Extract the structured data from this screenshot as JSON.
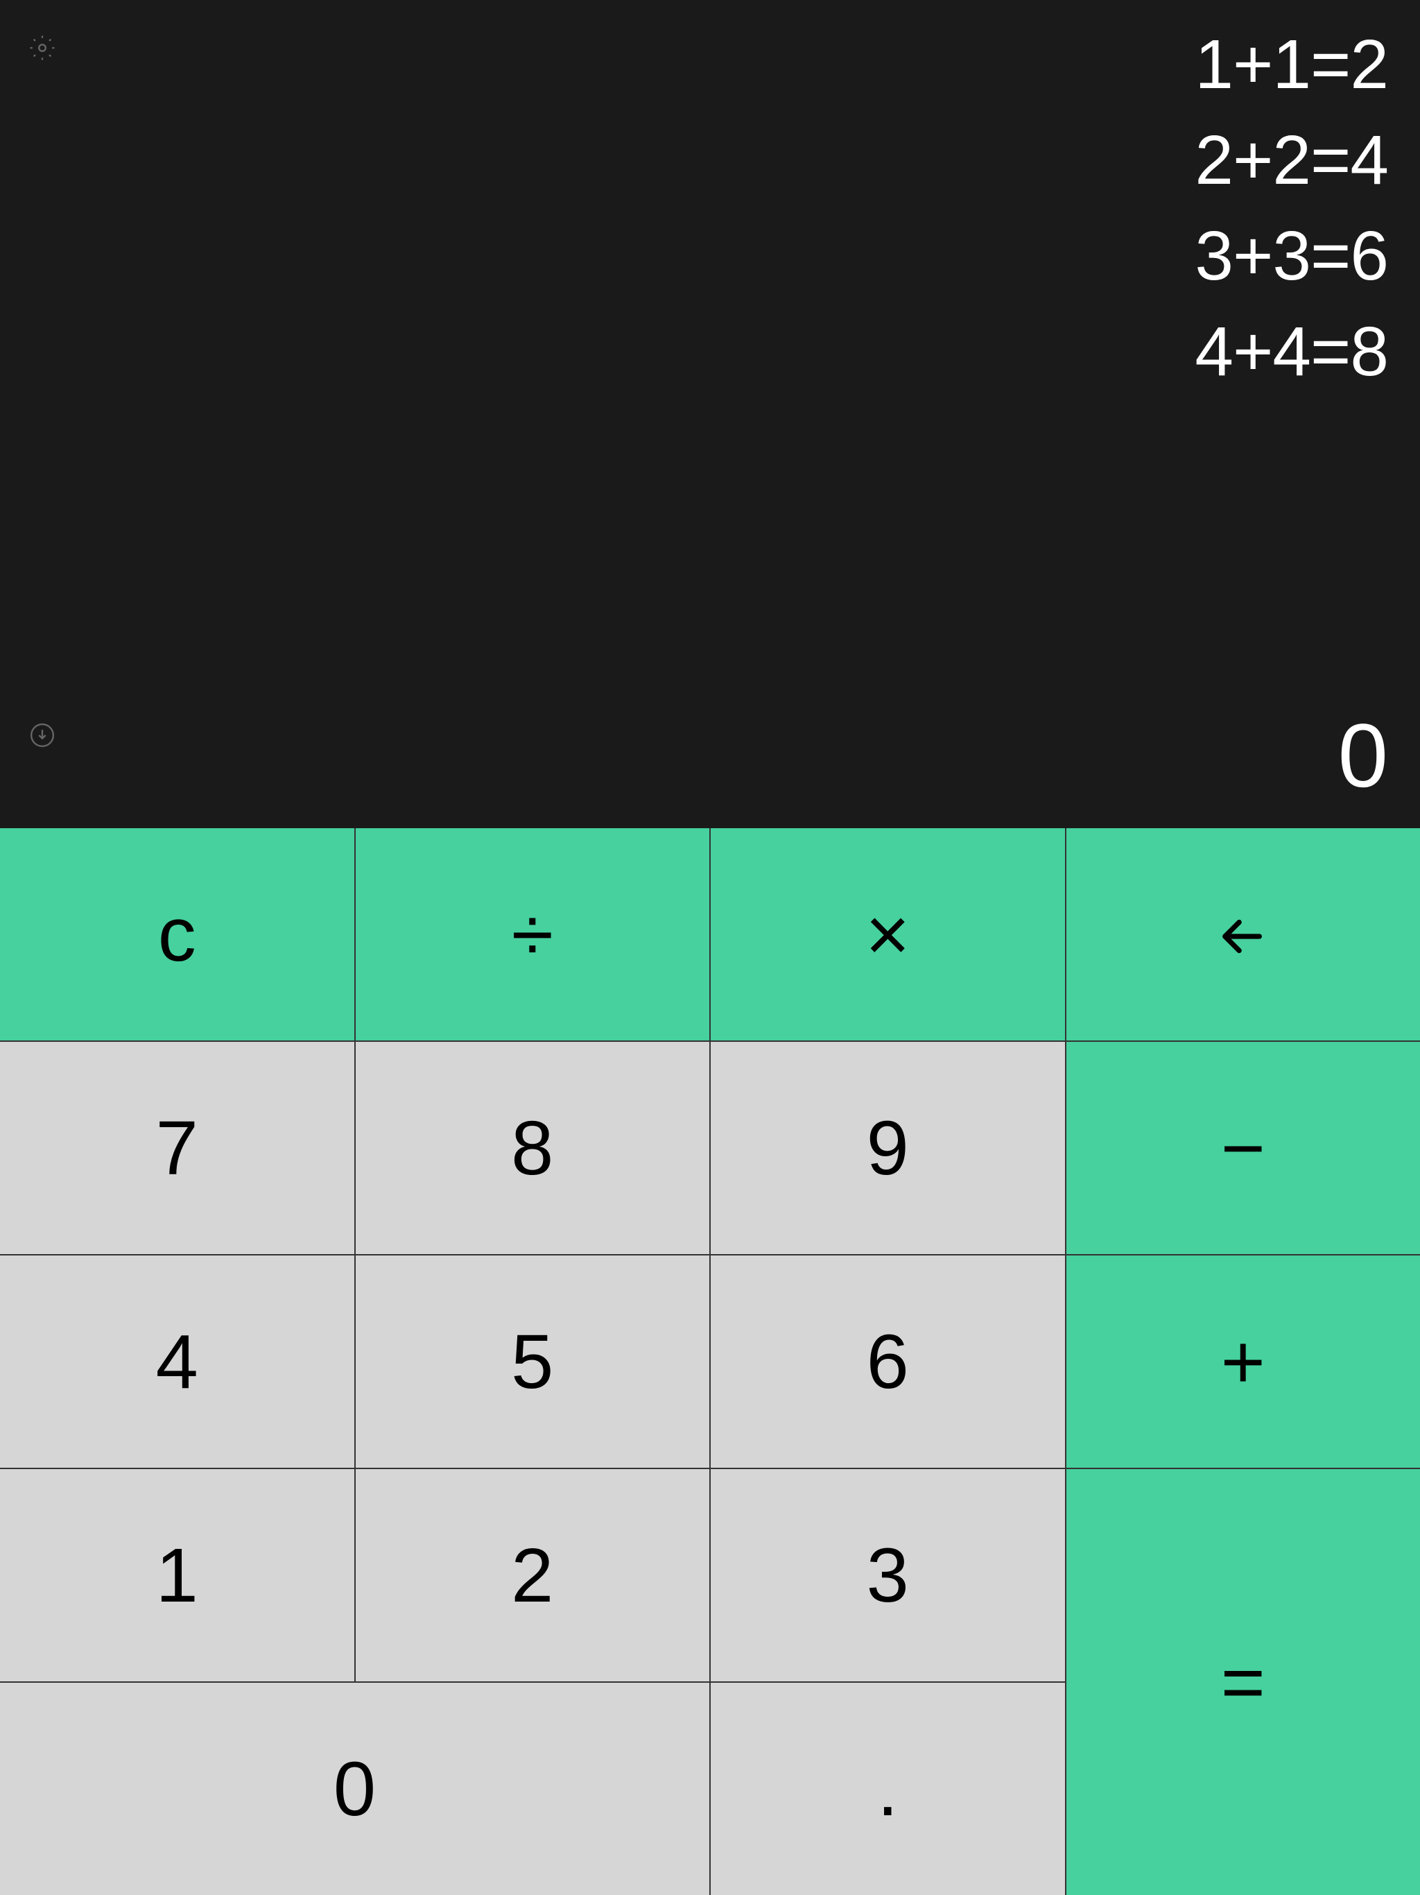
{
  "history": [
    "1+1=2",
    "2+2=4",
    "3+3=6",
    "4+4=8"
  ],
  "display": {
    "current": "0"
  },
  "keys": {
    "clear": "c",
    "divide": "÷",
    "multiply": "×",
    "backspace": "←",
    "seven": "7",
    "eight": "8",
    "nine": "9",
    "minus": "−",
    "four": "4",
    "five": "5",
    "six": "6",
    "plus": "+",
    "one": "1",
    "two": "2",
    "three": "3",
    "equals": "=",
    "zero": "0",
    "decimal": "."
  },
  "colors": {
    "background": "#1a1a1a",
    "operator": "#46d19e",
    "number": "#d6d6d6"
  }
}
